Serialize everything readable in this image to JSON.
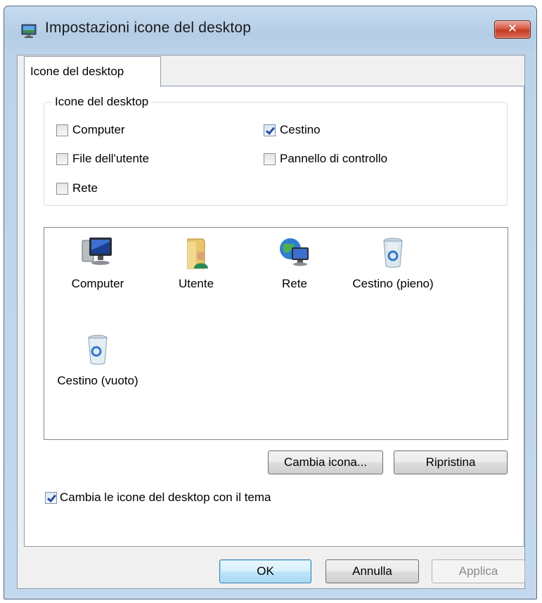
{
  "window": {
    "title": "Impostazioni icone del desktop",
    "close_icon": "close-icon",
    "close_glyph": "✕"
  },
  "tab": {
    "label": "Icone del desktop"
  },
  "group": {
    "legend": "Icone del desktop",
    "checkboxes": [
      {
        "label": "Computer",
        "checked": false
      },
      {
        "label": "Cestino",
        "checked": true
      },
      {
        "label": "File dell'utente",
        "checked": false
      },
      {
        "label": "Pannello di controllo",
        "checked": false
      },
      {
        "label": "Rete",
        "checked": false
      }
    ]
  },
  "icons": [
    {
      "label": "Computer",
      "icon": "computer-icon"
    },
    {
      "label": "Utente",
      "icon": "user-folder-icon"
    },
    {
      "label": "Rete",
      "icon": "network-globe-icon"
    },
    {
      "label": "Cestino (pieno)",
      "icon": "recycle-bin-full-icon"
    },
    {
      "label": "Cestino (vuoto)",
      "icon": "recycle-bin-empty-icon"
    }
  ],
  "buttons": {
    "change_icon": "Cambia icona...",
    "restore": "Ripristina",
    "ok": "OK",
    "cancel": "Annulla",
    "apply": "Applica"
  },
  "theme_checkbox": {
    "label": "Cambia le icone del desktop con il tema",
    "checked": true
  }
}
